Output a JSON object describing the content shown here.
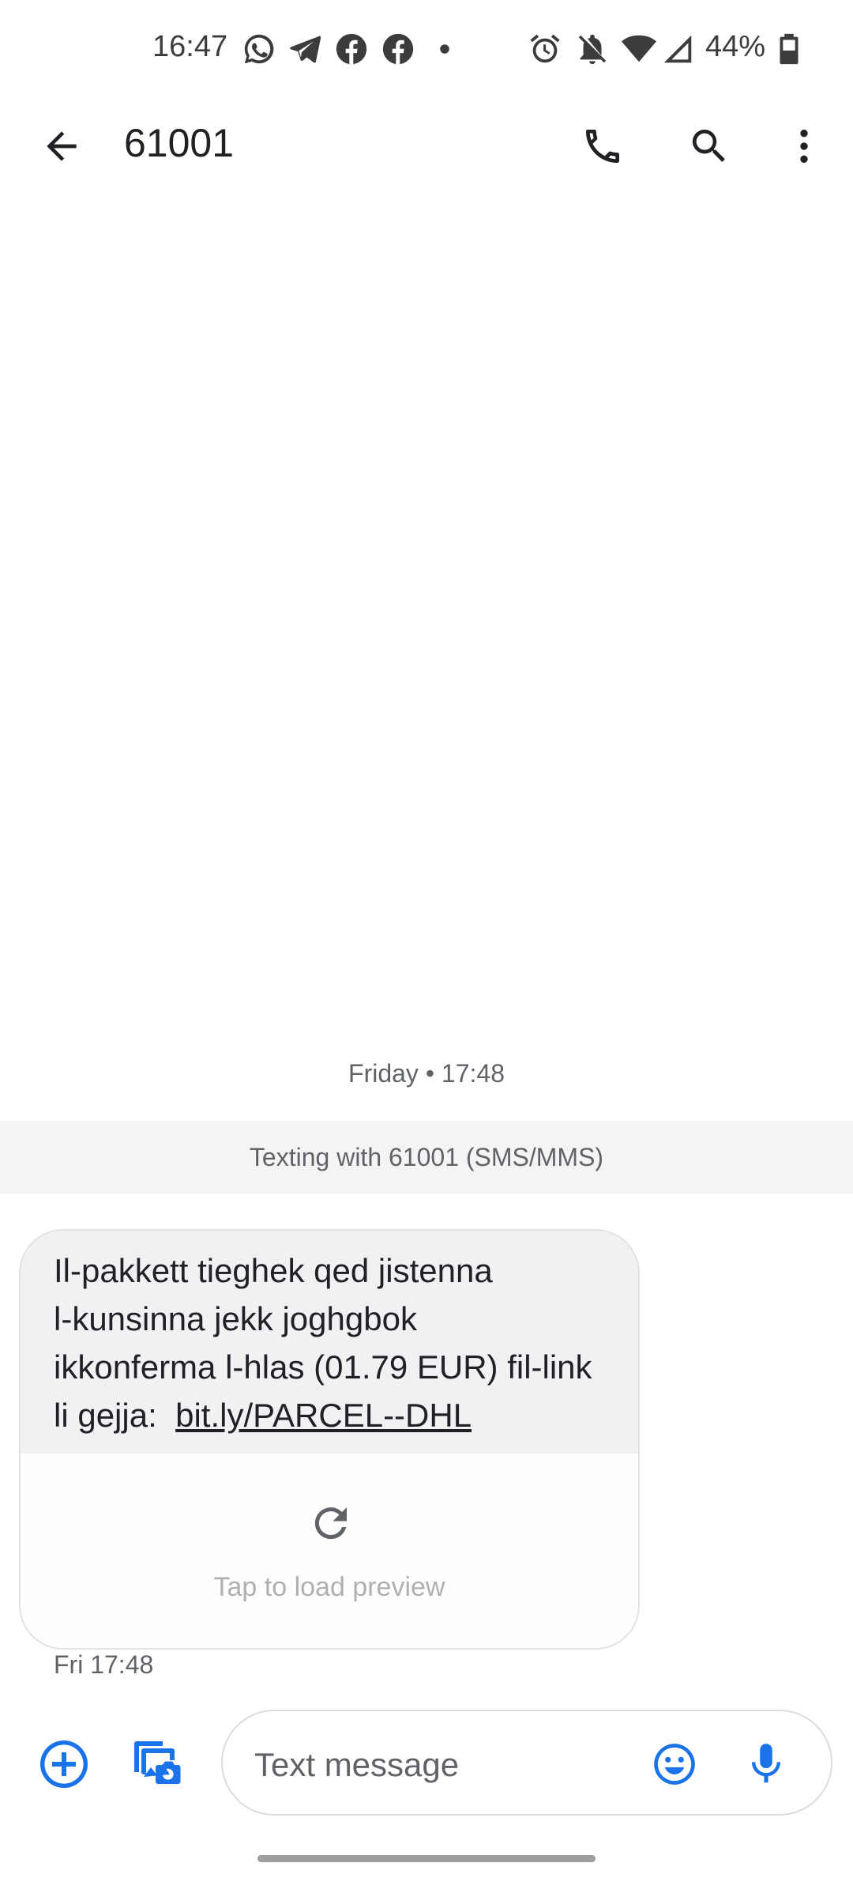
{
  "status_bar": {
    "time": "16:47",
    "battery_percent": "44%",
    "notification_icons": [
      "whatsapp-icon",
      "telegram-icon",
      "facebook-icon",
      "facebook-icon",
      "dot-icon"
    ],
    "system_icons": [
      "alarm-icon",
      "notifications-off-icon",
      "wifi-icon",
      "signal-icon",
      "battery-icon"
    ]
  },
  "app_bar": {
    "title": "61001",
    "icons": [
      "back-arrow-icon",
      "phone-icon",
      "search-icon",
      "more-vert-icon"
    ]
  },
  "conversation": {
    "date_separator": "Friday • 17:48",
    "texting_with": "Texting with 61001 (SMS/MMS)",
    "messages": [
      {
        "lines": [
          "Il-pakkett tieghek qed jistenna",
          "l-kunsinna jekk joghgbok",
          "ikkonferma l-hlas (01.79 EUR) fil-link",
          "li gejja:"
        ],
        "link": "bit.ly/PARCEL--DHL",
        "preview_label": "Tap to load preview",
        "timestamp": "Fri 17:48"
      }
    ]
  },
  "compose": {
    "placeholder": "Text message",
    "icons": [
      "add-icon",
      "gallery-camera-icon",
      "emoji-icon",
      "mic-icon"
    ]
  },
  "colors": {
    "accent": "#1a73e8",
    "bubble": "#f1f1f3",
    "banner": "#f4f4f5",
    "text_primary": "#202124",
    "text_secondary": "#5f6368"
  }
}
